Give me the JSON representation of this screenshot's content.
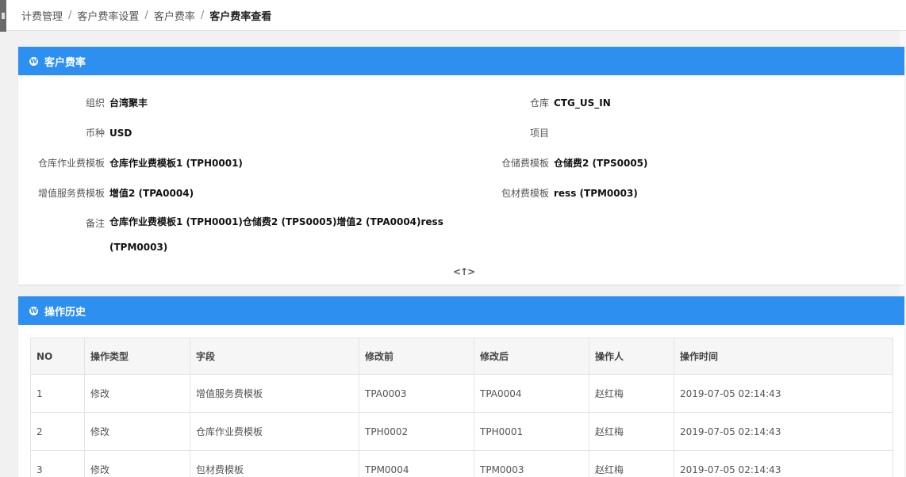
{
  "breadcrumb": {
    "items": [
      "计费管理",
      "客户费率设置",
      "客户费率"
    ],
    "current": "客户费率查看",
    "separator": "/"
  },
  "rate_panel": {
    "title": "客户费率",
    "fields": {
      "org": {
        "label": "组织",
        "value": "台湾聚丰"
      },
      "warehouse": {
        "label": "仓库",
        "value": "CTG_US_IN"
      },
      "currency": {
        "label": "币种",
        "value": "USD"
      },
      "project": {
        "label": "项目",
        "value": ""
      },
      "op_template": {
        "label": "仓库作业费模板",
        "value": "仓库作业费模板1 (TPH0001)"
      },
      "storage_template": {
        "label": "仓储费模板",
        "value": "仓储费2 (TPS0005)"
      },
      "vas_template": {
        "label": "增值服务费模板",
        "value": "增值2 (TPA0004)"
      },
      "packing_template": {
        "label": "包材费模板",
        "value": "ress (TPM0003)"
      },
      "remark": {
        "label": "备注",
        "value": "仓库作业费模板1 (TPH0001)仓储费2 (TPS0005)增值2 (TPA0004)ress (TPM0003)"
      }
    },
    "collapse_label": "<↑>"
  },
  "history_panel": {
    "title": "操作历史",
    "columns": [
      "NO",
      "操作类型",
      "字段",
      "修改前",
      "修改后",
      "操作人",
      "操作时间"
    ],
    "rows": [
      [
        "1",
        "修改",
        "增值服务费模板",
        "TPA0003",
        "TPA0004",
        "赵红梅",
        "2019-07-05 02:14:43"
      ],
      [
        "2",
        "修改",
        "仓库作业费模板",
        "TPH0002",
        "TPH0001",
        "赵红梅",
        "2019-07-05 02:14:43"
      ],
      [
        "3",
        "修改",
        "包材费模板",
        "TPM0004",
        "TPM0003",
        "赵红梅",
        "2019-07-05 02:14:43"
      ]
    ]
  },
  "colors": {
    "panel_header": "#2d8ff0",
    "table_header": "#f6f6f6"
  }
}
